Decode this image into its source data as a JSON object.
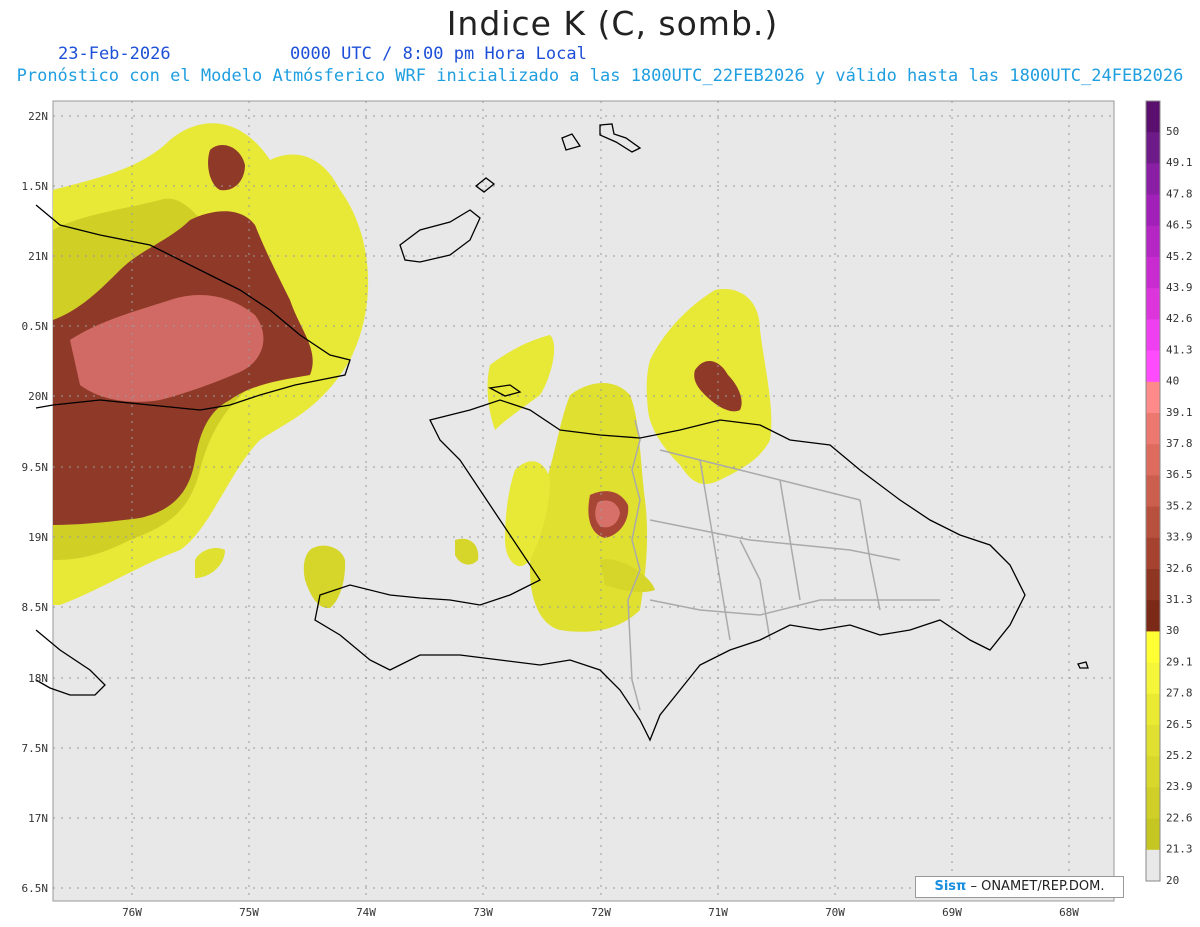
{
  "title": "Indice K (C, somb.)",
  "header": {
    "date": "23-Feb-2026",
    "time": "0000 UTC / 8:00 pm Hora Local",
    "description": "Pronóstico con el Modelo Atmósferico WRF inicializado a las 1800UTC_22FEB2026 y válido hasta las  1800UTC_24FEB2026"
  },
  "map": {
    "lat_labels": [
      "22N",
      "1.5N",
      "21N",
      "0.5N",
      "20N",
      "9.5N",
      "19N",
      "8.5N",
      "18N",
      "7.5N",
      "17N",
      "6.5N"
    ],
    "lon_labels": [
      "76W",
      "75W",
      "74W",
      "73W",
      "72W",
      "71W",
      "70W",
      "69W",
      "68W"
    ]
  },
  "legend": {
    "labels": [
      "50",
      "49.1",
      "47.8",
      "46.5",
      "45.2",
      "43.9",
      "42.6",
      "41.3",
      "40",
      "39.1",
      "37.8",
      "36.5",
      "35.2",
      "33.9",
      "32.6",
      "31.3",
      "30",
      "29.1",
      "27.8",
      "26.5",
      "25.2",
      "23.9",
      "22.6",
      "21.3",
      "20"
    ],
    "colors": [
      "#5a0f6e",
      "#6e1a88",
      "#8a1fa6",
      "#a020b8",
      "#b427c4",
      "#c82bd0",
      "#dd35dc",
      "#ee3ff0",
      "#ff4cff",
      "#ff8a8a",
      "#ec7870",
      "#de6c5e",
      "#cc5e4e",
      "#b8503e",
      "#a64230",
      "#8f3622",
      "#7a2a16",
      "#ffff33",
      "#f5f53a",
      "#eaea33",
      "#e0e030",
      "#d8d82c",
      "#cfcf27",
      "#c6c622",
      "#e8e8e8"
    ]
  },
  "colors": {
    "background": "#e8e8e8",
    "k_low": "#d6d62a",
    "k_mid": "#eded3a",
    "k_high": "#8f3a28",
    "k_very_high": "#d8706a",
    "coastline": "#000000",
    "province_lines": "#aaaaaa"
  },
  "credit": {
    "brand": "Sisπ",
    "text": "– ONAMET/REP.DOM."
  }
}
